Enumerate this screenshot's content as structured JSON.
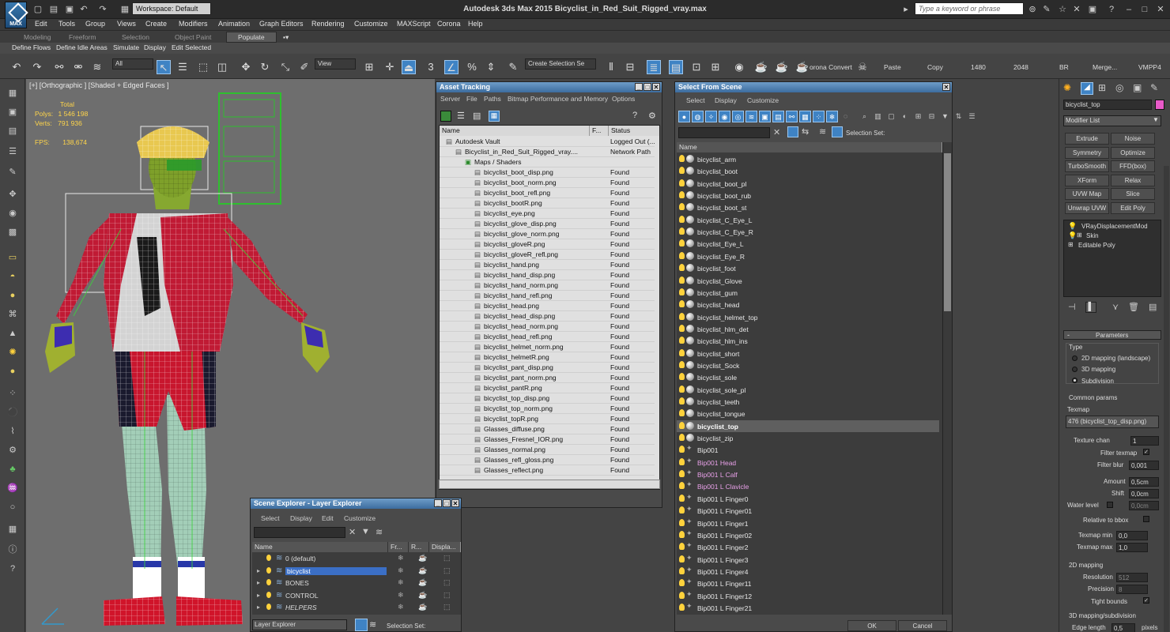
{
  "title_bar": {
    "app_title": "Autodesk 3ds Max  2015    Bicyclist_in_Red_Suit_Rigged_vray.max",
    "workspace": "Workspace: Default",
    "search_placeholder": "Type a keyword or phrase",
    "logo_text": "MAX"
  },
  "menu": [
    "Edit",
    "Tools",
    "Group",
    "Views",
    "Create",
    "Modifiers",
    "Animation",
    "Graph Editors",
    "Rendering",
    "Customize",
    "MAXScript",
    "Corona",
    "Help"
  ],
  "ribbon_tabs": [
    "Modeling",
    "Freeform",
    "Selection",
    "Object Paint",
    "Populate"
  ],
  "sub_ribbon": [
    "Define Flows",
    "Define Idle Areas",
    "Simulate",
    "Display",
    "Edit Selected"
  ],
  "toolbar": {
    "filter": "All",
    "refcoord": "View",
    "selection_set": "Create Selection Se",
    "corona_convert": "orona Convert",
    "paste": "Paste",
    "copy": "Copy",
    "w": "1480",
    "h": "2048",
    "br": "BR",
    "merge": "Merge...",
    "vmpp": "VMPP4"
  },
  "viewport": {
    "label": "[+] [Orthographic ] [Shaded + Edged Faces ]",
    "total_label": "Total",
    "polys_label": "Polys:",
    "polys_value": "1 546 198",
    "verts_label": "Verts:",
    "verts_value": "791 936",
    "fps_label": "FPS:",
    "fps_value": "138,674"
  },
  "asset_tracking": {
    "title": "Asset Tracking",
    "menu": [
      "Server",
      "File",
      "Paths",
      "Bitmap Performance and Memory",
      "Options"
    ],
    "columns": [
      "Name",
      "F...",
      "Status"
    ],
    "rows": [
      {
        "name": "Autodesk Vault",
        "status": "Logged Out (..."
      },
      {
        "name": "Bicyclist_in_Red_Suit_Rigged_vray....",
        "status": "Network Path"
      },
      {
        "name": "Maps / Shaders",
        "status": ""
      },
      {
        "name": "bicyclist_boot_disp.png",
        "status": "Found"
      },
      {
        "name": "bicyclist_boot_norm.png",
        "status": "Found"
      },
      {
        "name": "bicyclist_boot_refl.png",
        "status": "Found"
      },
      {
        "name": "bicyclist_bootR.png",
        "status": "Found"
      },
      {
        "name": "bicyclist_eye.png",
        "status": "Found"
      },
      {
        "name": "bicyclist_glove_disp.png",
        "status": "Found"
      },
      {
        "name": "bicyclist_glove_norm.png",
        "status": "Found"
      },
      {
        "name": "bicyclist_gloveR.png",
        "status": "Found"
      },
      {
        "name": "bicyclist_gloveR_refl.png",
        "status": "Found"
      },
      {
        "name": "bicyclist_hand.png",
        "status": "Found"
      },
      {
        "name": "bicyclist_hand_disp.png",
        "status": "Found"
      },
      {
        "name": "bicyclist_hand_norm.png",
        "status": "Found"
      },
      {
        "name": "bicyclist_hand_refl.png",
        "status": "Found"
      },
      {
        "name": "bicyclist_head.png",
        "status": "Found"
      },
      {
        "name": "bicyclist_head_disp.png",
        "status": "Found"
      },
      {
        "name": "bicyclist_head_norm.png",
        "status": "Found"
      },
      {
        "name": "bicyclist_head_refl.png",
        "status": "Found"
      },
      {
        "name": "bicyclist_helmet_norm.png",
        "status": "Found"
      },
      {
        "name": "bicyclist_helmetR.png",
        "status": "Found"
      },
      {
        "name": "bicyclist_pant_disp.png",
        "status": "Found"
      },
      {
        "name": "bicyclist_pant_norm.png",
        "status": "Found"
      },
      {
        "name": "bicyclist_pantR.png",
        "status": "Found"
      },
      {
        "name": "bicyclist_top_disp.png",
        "status": "Found"
      },
      {
        "name": "bicyclist_top_norm.png",
        "status": "Found"
      },
      {
        "name": "bicyclist_topR.png",
        "status": "Found"
      },
      {
        "name": "Glasses_diffuse.png",
        "status": "Found"
      },
      {
        "name": "Glasses_Fresnel_IOR.png",
        "status": "Found"
      },
      {
        "name": "Glasses_normal.png",
        "status": "Found"
      },
      {
        "name": "Glasses_refl_gloss.png",
        "status": "Found"
      },
      {
        "name": "Glasses_reflect.png",
        "status": "Found"
      }
    ]
  },
  "scene_explorer": {
    "title": "Scene Explorer - Layer Explorer",
    "menu": [
      "Select",
      "Display",
      "Edit",
      "Customize"
    ],
    "columns": [
      "Name",
      "Fr...",
      "R...",
      "Displa..."
    ],
    "layers": [
      "0 (default)",
      "bicyclist",
      "BONES",
      "CONTROL",
      "HELPERS"
    ],
    "footer_dropdown": "Layer Explorer",
    "footer_selset": "Selection Set:"
  },
  "select_from_scene": {
    "title": "Select From Scene",
    "menu": [
      "Select",
      "Display",
      "Customize"
    ],
    "selection_set": "Selection Set:",
    "column": "Name",
    "objects": [
      "bicyclist_arm",
      "bicyclist_boot",
      "bicyclist_boot_pl",
      "bicyclist_boot_rub",
      "bicyclist_boot_st",
      "bicyclist_C_Eye_L",
      "bicyclist_C_Eye_R",
      "bicyclist_Eye_L",
      "bicyclist_Eye_R",
      "bicyclist_foot",
      "bicyclist_Glove",
      "bicyclist_gum",
      "bicyclist_head",
      "bicyclist_helmet_top",
      "bicyclist_hlm_det",
      "bicyclist_hlm_ins",
      "bicyclist_short",
      "bicyclist_Sock",
      "bicyclist_sole",
      "bicyclist_sole_pl",
      "bicyclist_teeth",
      "bicyclist_tongue",
      "bicyclist_top",
      "bicyclist_zip"
    ],
    "bones": [
      "Bip001",
      "Bip001 Head",
      "Bip001 L Calf",
      "Bip001 L Clavicle",
      "Bip001 L Finger0",
      "Bip001 L Finger01",
      "Bip001 L Finger1",
      "Bip001 L Finger02",
      "Bip001 L Finger2",
      "Bip001 L Finger3",
      "Bip001 L Finger4",
      "Bip001 L Finger11",
      "Bip001 L Finger12",
      "Bip001 L Finger21"
    ],
    "ok": "OK",
    "cancel": "Cancel"
  },
  "command_panel": {
    "object_name": "bicyclist_top",
    "modifier_list": "Modifier List",
    "buttons": [
      "Extrude",
      "Noise",
      "Symmetry",
      "Optimize",
      "TurboSmooth",
      "FFD(box)",
      "XForm",
      "Relax",
      "UVW Map",
      "Slice",
      "Unwrap UVW",
      "Edit Poly"
    ],
    "stack": [
      "VRayDisplacementMod",
      "Skin",
      "Editable Poly"
    ],
    "parameters": "Parameters",
    "type_label": "Type",
    "type_options": [
      "2D mapping (landscape)",
      "3D mapping",
      "Subdivision"
    ],
    "common_params": "Common params",
    "texmap_label": "Texmap",
    "texmap_value": "476 (bicyclist_top_disp.png)",
    "texture_chan_label": "Texture chan",
    "texture_chan_value": "1",
    "filter_texmap": "Filter texmap",
    "filter_blur_label": "Filter blur",
    "filter_blur_value": "0,001",
    "amount_label": "Amount",
    "amount_value": "0,5cm",
    "shift_label": "Shift",
    "shift_value": "0,0cm",
    "water_level_label": "Water level",
    "water_level_value": "0,0cm",
    "relative_bbox": "Relative to bbox",
    "texmap_min_label": "Texmap min",
    "texmap_min_value": "0,0",
    "texmap_max_label": "Texmap max",
    "texmap_max_value": "1,0",
    "mapping_2d": "2D mapping",
    "resolution_label": "Resolution",
    "resolution_value": "512",
    "precision_label": "Precision",
    "precision_value": "8",
    "tight_bounds": "Tight bounds",
    "mapping_3d": "3D mapping/subdivision",
    "edge_length_label": "Edge length",
    "edge_length_value": "0,5",
    "pixels": "pixels"
  },
  "colors": {
    "accent": "#3f83c4",
    "object_color": "#e85ac8",
    "bone_text": "#e8a0e8"
  }
}
